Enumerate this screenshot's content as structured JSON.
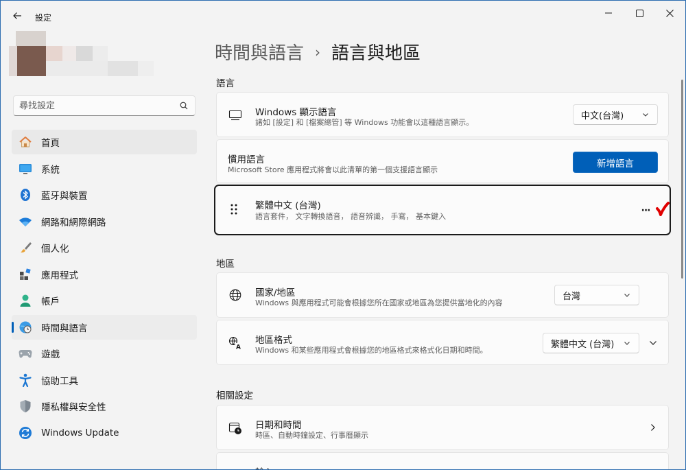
{
  "window": {
    "title": "設定",
    "back_icon": "back-arrow-icon",
    "minimize_icon": "minimize-icon",
    "maximize_icon": "maximize-icon",
    "close_icon": "close-icon"
  },
  "search": {
    "placeholder": "尋找設定",
    "icon": "search-icon"
  },
  "sidebar": {
    "items": [
      {
        "label": "首頁",
        "icon": "home-icon"
      },
      {
        "label": "系統",
        "icon": "monitor-icon"
      },
      {
        "label": "藍牙與裝置",
        "icon": "bluetooth-icon"
      },
      {
        "label": "網路和網際網路",
        "icon": "wifi-icon"
      },
      {
        "label": "個人化",
        "icon": "brush-icon"
      },
      {
        "label": "應用程式",
        "icon": "apps-icon"
      },
      {
        "label": "帳戶",
        "icon": "person-icon"
      },
      {
        "label": "時間與語言",
        "icon": "clock-globe-icon"
      },
      {
        "label": "遊戲",
        "icon": "gamepad-icon"
      },
      {
        "label": "協助工具",
        "icon": "accessibility-icon"
      },
      {
        "label": "隱私權與安全性",
        "icon": "shield-icon"
      },
      {
        "label": "Windows Update",
        "icon": "update-icon"
      }
    ]
  },
  "breadcrumb": {
    "parent": "時間與語言",
    "separator": "›",
    "current": "語言與地區"
  },
  "language_section": {
    "title": "語言",
    "display_language": {
      "title": "Windows 顯示語言",
      "subtitle": "諸如 [設定] 和 [檔案總管] 等 Windows 功能會以這種語言顯示。",
      "value": "中文(台灣)",
      "icon": "display-icon"
    },
    "preferred": {
      "title": "慣用語言",
      "subtitle": "Microsoft Store 應用程式將會以此清單的第一個支援語言顯示",
      "button": "新增語言"
    },
    "installed": {
      "title": "繁體中文 (台灣)",
      "subtitle": "語言套件， 文字轉換語音， 語音辨識， 手寫， 基本鍵入",
      "more": "···",
      "drag_icon": "drag-handle-icon"
    }
  },
  "region_section": {
    "title": "地區",
    "country": {
      "title": "國家/地區",
      "subtitle": "Windows 與應用程式可能會根據您所在國家或地區為您提供當地化的內容",
      "value": "台灣",
      "icon": "globe-icon"
    },
    "format": {
      "title": "地區格式",
      "subtitle": "Windows 和某些應用程式會根據您的地區格式來格式化日期和時間。",
      "value": "繁體中文 (台灣)",
      "icon": "language-format-icon"
    }
  },
  "related_section": {
    "title": "相關設定",
    "datetime": {
      "title": "日期和時間",
      "subtitle": "時區、自動時鐘設定、行事曆顯示",
      "icon": "calendar-clock-icon"
    },
    "next_title": "輸入"
  },
  "colors": {
    "accent": "#005fb8",
    "cursor_mark": "#e00000"
  }
}
